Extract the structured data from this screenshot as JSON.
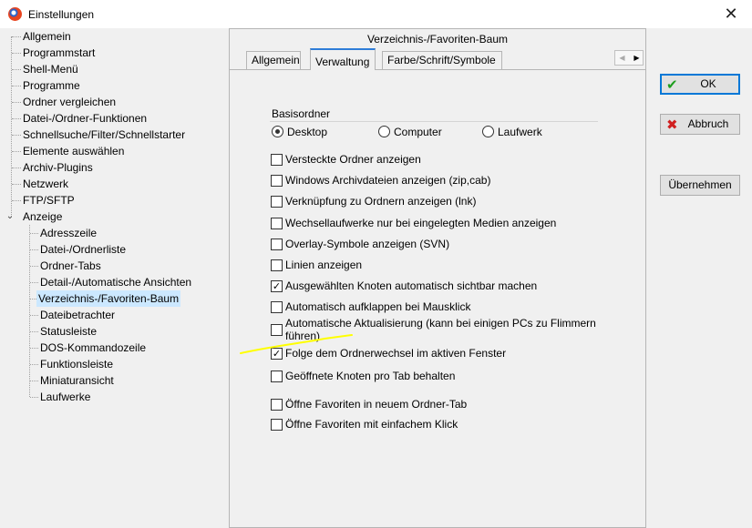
{
  "window": {
    "title": "Einstellungen"
  },
  "tree": {
    "items": [
      {
        "label": "Allgemein"
      },
      {
        "label": "Programmstart"
      },
      {
        "label": "Shell-Menü"
      },
      {
        "label": "Programme"
      },
      {
        "label": "Ordner vergleichen"
      },
      {
        "label": "Datei-/Ordner-Funktionen"
      },
      {
        "label": "Schnellsuche/Filter/Schnellstarter"
      },
      {
        "label": "Elemente auswählen"
      },
      {
        "label": "Archiv-Plugins"
      },
      {
        "label": "Netzwerk"
      },
      {
        "label": "FTP/SFTP"
      },
      {
        "label": "Anzeige"
      }
    ],
    "children": [
      {
        "label": "Adresszeile"
      },
      {
        "label": "Datei-/Ordnerliste"
      },
      {
        "label": "Ordner-Tabs"
      },
      {
        "label": "Detail-/Automatische Ansichten"
      },
      {
        "label": "Verzeichnis-/Favoriten-Baum"
      },
      {
        "label": "Dateibetrachter"
      },
      {
        "label": "Statusleiste"
      },
      {
        "label": "DOS-Kommandozeile"
      },
      {
        "label": "Funktionsleiste"
      },
      {
        "label": "Miniaturansicht"
      },
      {
        "label": "Laufwerke"
      }
    ],
    "selected": "Verzeichnis-/Favoriten-Baum"
  },
  "panel": {
    "header": "Verzeichnis-/Favoriten-Baum",
    "tabs": [
      {
        "label": "Allgemein"
      },
      {
        "label": "Verwaltung"
      },
      {
        "label": "Farbe/Schrift/Symbole"
      }
    ],
    "active_tab": "Verwaltung",
    "basisordner": {
      "title": "Basisordner",
      "options": [
        {
          "label": "Desktop",
          "selected": true
        },
        {
          "label": "Computer",
          "selected": false
        },
        {
          "label": "Laufwerk",
          "selected": false
        }
      ]
    },
    "checkboxes": [
      {
        "label": "Versteckte Ordner anzeigen",
        "checked": false
      },
      {
        "label": "Windows Archivdateien anzeigen (zip,cab)",
        "checked": false
      },
      {
        "label": "Verknüpfung zu Ordnern anzeigen (lnk)",
        "checked": false
      },
      {
        "label": "Wechsellaufwerke nur bei eingelegten Medien anzeigen",
        "checked": false
      },
      {
        "label": "Overlay-Symbole anzeigen (SVN)",
        "checked": false
      },
      {
        "label": "Linien anzeigen",
        "checked": false
      },
      {
        "label": "Ausgewählten Knoten automatisch sichtbar machen",
        "checked": true
      },
      {
        "label": "Automatisch aufklappen bei Mausklick",
        "checked": false
      },
      {
        "label": "Automatische Aktualisierung (kann bei einigen PCs zu Flimmern führen)",
        "checked": false
      },
      {
        "label": "Folge dem Ordnerwechsel im aktiven Fenster",
        "checked": true
      },
      {
        "label": "Geöffnete Knoten pro Tab behalten",
        "checked": false
      },
      {
        "label": "Öffne Favoriten in neuem Ordner-Tab",
        "checked": false
      },
      {
        "label": "Öffne Favoriten mit einfachem Klick",
        "checked": false
      }
    ]
  },
  "buttons": {
    "ok": "OK",
    "cancel": "Abbruch",
    "apply": "Übernehmen"
  },
  "colors": {
    "selection": "#cce8ff",
    "accent": "#0078d7",
    "annotation": "#ffff00"
  }
}
